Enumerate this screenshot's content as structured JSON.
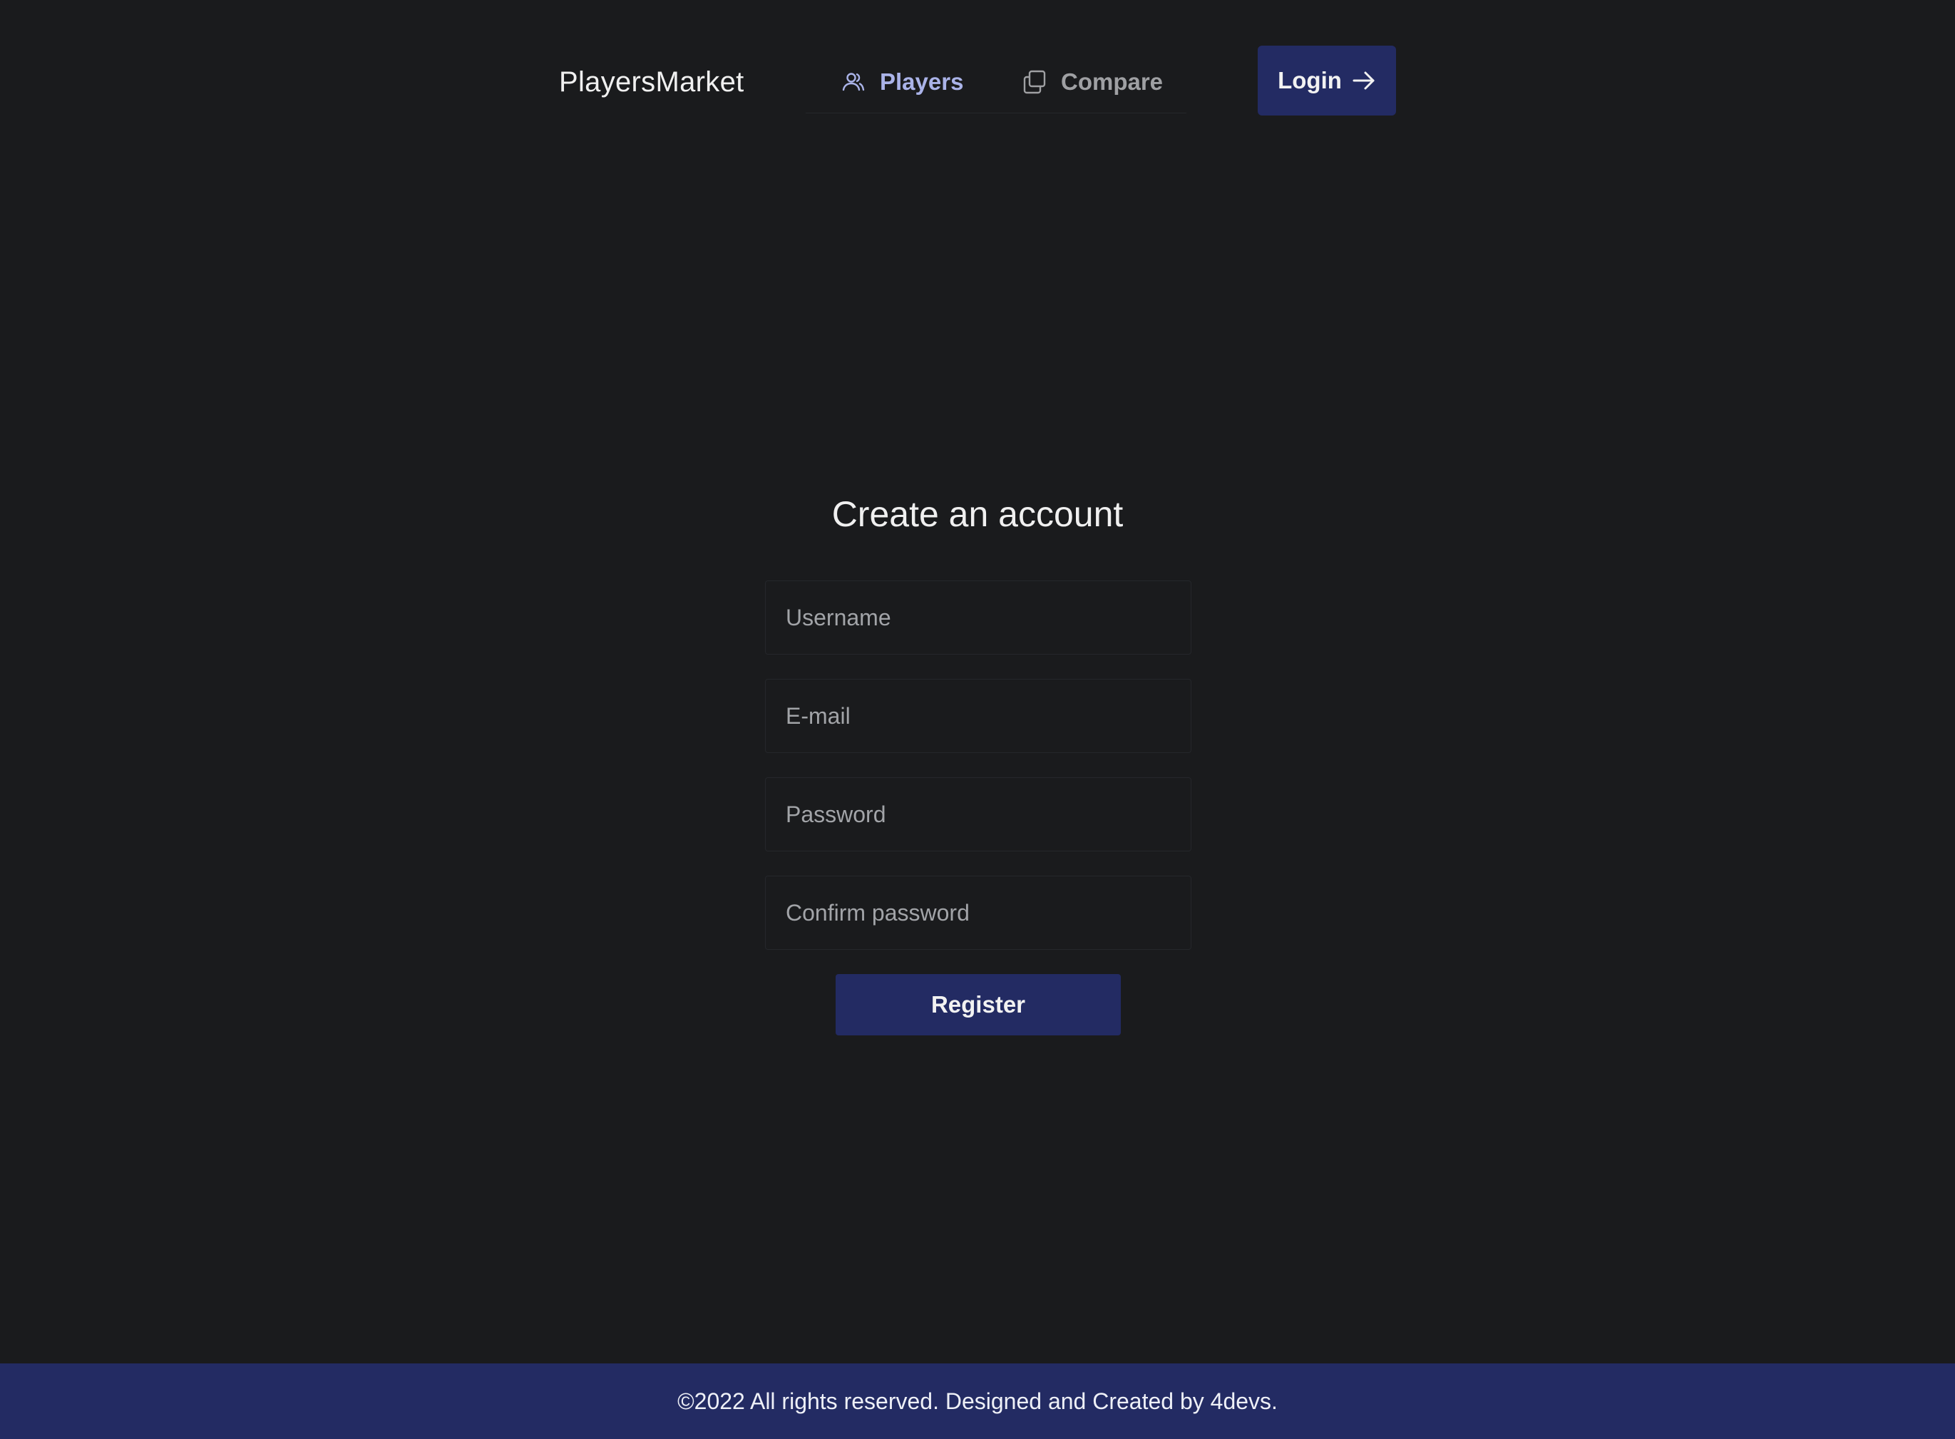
{
  "header": {
    "brand": "PlayersMarket",
    "nav": [
      {
        "label": "Players",
        "icon": "users-icon",
        "active": true
      },
      {
        "label": "Compare",
        "icon": "compare-icon",
        "active": false
      }
    ],
    "login_label": "Login"
  },
  "form": {
    "title": "Create an account",
    "fields": {
      "username": {
        "placeholder": "Username",
        "value": ""
      },
      "email": {
        "placeholder": "E-mail",
        "value": ""
      },
      "password": {
        "placeholder": "Password",
        "value": ""
      },
      "confirm_password": {
        "placeholder": "Confirm password",
        "value": ""
      }
    },
    "submit_label": "Register"
  },
  "footer": {
    "text": "©2022 All rights reserved. Designed and Created by 4devs."
  },
  "colors": {
    "background": "#1a1b1d",
    "accent": "#232b63",
    "active_nav": "#aab3e8",
    "inactive_nav": "#9fa0a3"
  }
}
